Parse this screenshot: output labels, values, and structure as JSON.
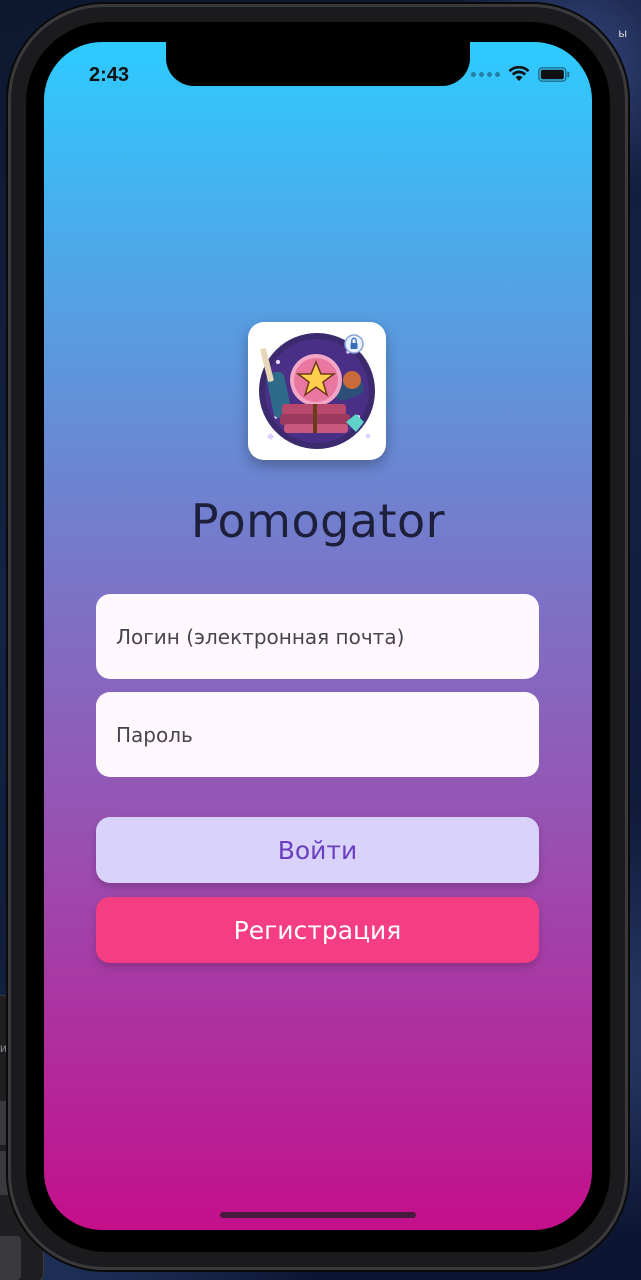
{
  "status_bar": {
    "time": "2:43"
  },
  "app": {
    "name": "Pomogator",
    "icon": "app-logo-icon"
  },
  "login_form": {
    "login_placeholder": "Логин (электронная почта)",
    "password_placeholder": "Пароль",
    "login_button": "Войти",
    "register_button": "Регистрация"
  },
  "desktop": {
    "search_label": "иск",
    "top_label": "ы"
  },
  "colors": {
    "gradient_top": "#2ecbff",
    "gradient_bottom": "#c40f8a",
    "login_button_bg": "#d9d3fb",
    "login_button_text": "#6a3fbf",
    "register_button_bg": "#f53d83",
    "field_bg": "#fff8fc"
  }
}
